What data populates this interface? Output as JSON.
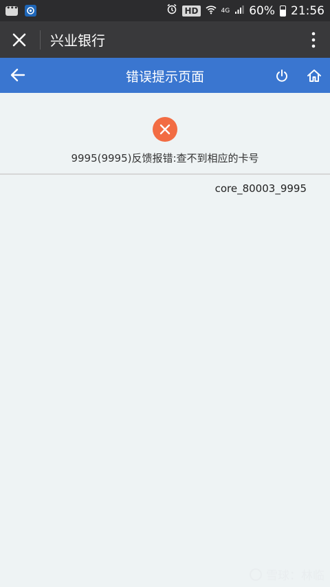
{
  "status_bar": {
    "hd_label": "HD",
    "network": "4G",
    "battery_percent": "60%",
    "time": "21:56"
  },
  "app_bar": {
    "title": "兴业银行"
  },
  "header": {
    "title": "错误提示页面"
  },
  "error": {
    "message": "9995(9995)反馈报错:查不到相应的卡号",
    "code": "core_80003_9995"
  },
  "watermark": {
    "text": "雪球：林临"
  },
  "colors": {
    "status_bar_bg": "#2c2c2e",
    "app_bar_bg": "#39393b",
    "header_bg": "#3a76d0",
    "error_icon_bg": "#f26c43",
    "page_bg": "#eef3f4"
  }
}
